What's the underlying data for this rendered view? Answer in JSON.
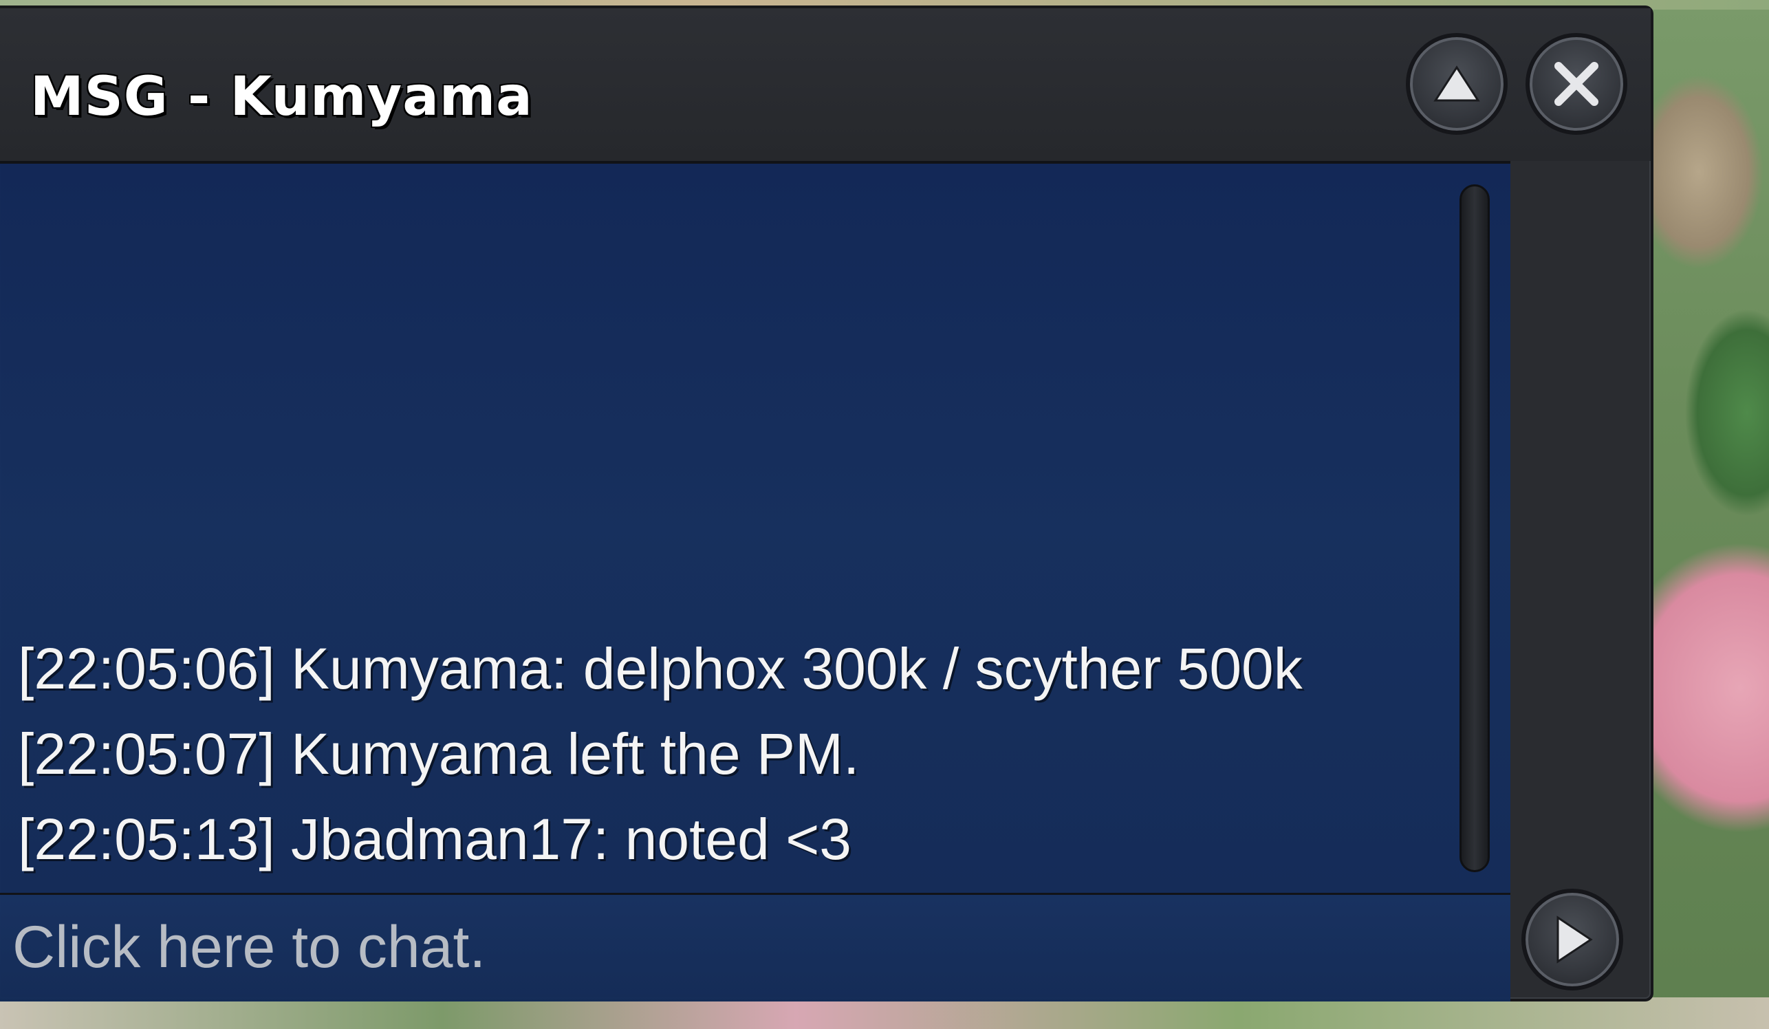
{
  "window": {
    "title": "MSG - Kumyama"
  },
  "icons": {
    "minimize": "arrow-up-icon",
    "close": "close-icon",
    "send": "play-arrow-icon"
  },
  "messages": [
    {
      "text": "[22:05:06] Kumyama: delphox 300k / scyther 500k"
    },
    {
      "text": "[22:05:07] Kumyama left the PM."
    },
    {
      "text": "[22:05:13] Jbadman17: noted <3"
    }
  ],
  "input": {
    "placeholder": "Click here to chat."
  },
  "colors": {
    "chat_bg": "#162f5e",
    "frame": "#2a2c30",
    "text": "#f4f4f4"
  }
}
